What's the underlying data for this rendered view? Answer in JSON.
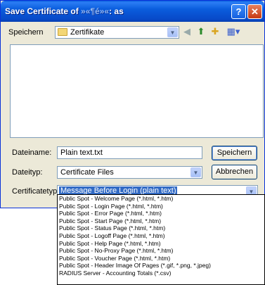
{
  "window": {
    "title": "Save Certificate of ",
    "title_obscured": "»«¶é»«",
    "title_suffix": ": as",
    "help_label": "?",
    "close_label": "✕"
  },
  "save_in": {
    "label": "Speichern",
    "value": "Zertifikate"
  },
  "toolbar": {
    "back_icon": "back-icon",
    "up_icon": "up-folder-icon",
    "new_folder_icon": "new-folder-icon",
    "views_icon": "views-menu-icon"
  },
  "filename": {
    "label": "Dateiname:",
    "value": "Plain text.txt"
  },
  "filetype": {
    "label": "Dateityp:",
    "value": "Certificate Files"
  },
  "certtype": {
    "label": "Certificatetype:",
    "value": "Message Before Login (plain text)"
  },
  "buttons": {
    "save": "Speichern",
    "cancel": "Abbrechen"
  },
  "dropdown_options": [
    "Public Spot - Welcome Page (*.html, *.htm)",
    "Public Spot - Login Page (*.html, *.htm)",
    "Public Spot - Error Page (*.html, *.htm)",
    "Public Spot - Start Page (*.html, *.htm)",
    "Public Spot - Status Page (*.html, *.htm)",
    "Public Spot - Logoff Page (*.html, *.htm)",
    "Public Spot - Help Page (*.html, *.htm)",
    "Public Spot - No-Proxy Page (*.html, *.htm)",
    "Public Spot - Voucher Page (*.html, *.htm)",
    "Public Spot - Header Image Of Pages (*.gif, *.png, *.jpeg)",
    "RADIUS Server - Accounting Totals (*.csv)"
  ]
}
